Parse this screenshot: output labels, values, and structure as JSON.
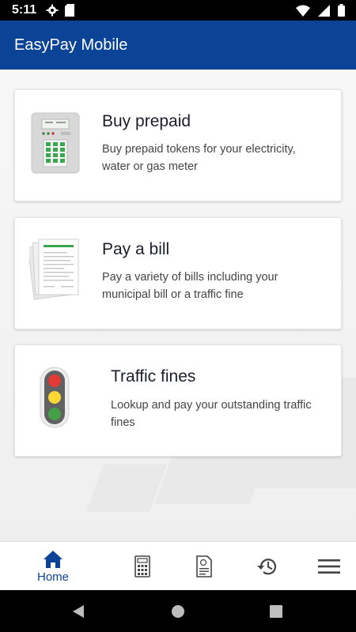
{
  "status_bar": {
    "time": "5:11"
  },
  "app_bar": {
    "title": "EasyPay Mobile"
  },
  "cards": [
    {
      "title": "Buy prepaid",
      "description": "Buy prepaid tokens for your electricity, water or gas meter",
      "icon": "prepaid-meter-icon"
    },
    {
      "title": "Pay a bill",
      "description": "Pay a variety of bills including your municipal bill or a traffic fine",
      "icon": "bill-document-icon"
    },
    {
      "title": "Traffic fines",
      "description": "Lookup and pay your outstanding traffic fines",
      "icon": "traffic-light-icon"
    }
  ],
  "bottom_nav": {
    "items": [
      {
        "label": "Home",
        "icon": "home-icon",
        "active": true
      },
      {
        "label": "",
        "icon": "calculator-icon"
      },
      {
        "label": "",
        "icon": "receipt-icon"
      },
      {
        "label": "",
        "icon": "history-icon"
      },
      {
        "label": "",
        "icon": "menu-icon"
      }
    ]
  },
  "colors": {
    "primary": "#0b4496",
    "status_bar": "#000000",
    "card": "#ffffff"
  }
}
